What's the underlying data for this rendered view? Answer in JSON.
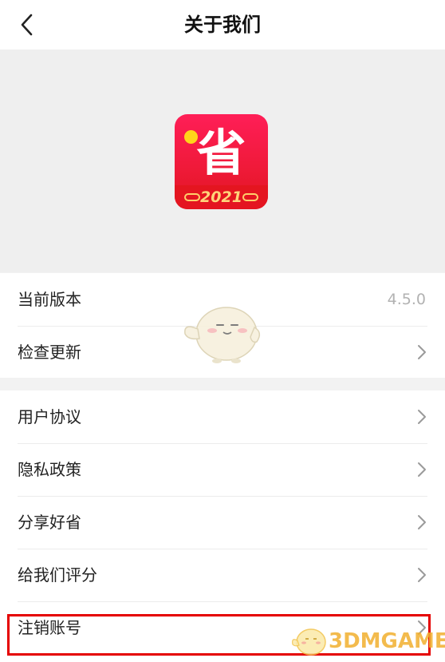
{
  "header": {
    "title": "关于我们",
    "back_icon": "chevron-left-icon"
  },
  "logo": {
    "char": "省",
    "year": "2021",
    "colors": {
      "background": "#f01a3a",
      "dot": "#ffd51a",
      "year": "#ffd47a"
    }
  },
  "version_group": {
    "current_version_label": "当前版本",
    "current_version_value": "4.5.0",
    "check_update_label": "检查更新"
  },
  "menu": {
    "items": [
      {
        "label": "用户协议"
      },
      {
        "label": "隐私政策"
      },
      {
        "label": "分享好省"
      },
      {
        "label": "给我们评分"
      },
      {
        "label": "注销账号"
      }
    ]
  },
  "annotation": {
    "highlight_color": "#e50000"
  },
  "watermark": {
    "text": "3DMGAME"
  }
}
